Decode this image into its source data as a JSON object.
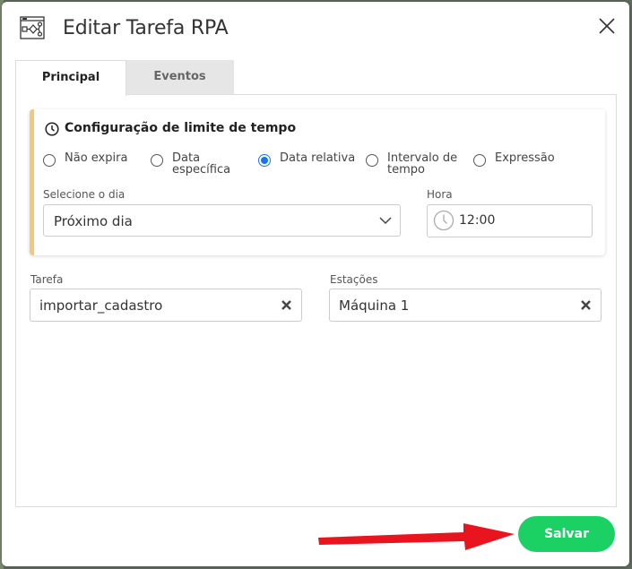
{
  "dialog": {
    "title": "Editar Tarefa RPA",
    "icons": {
      "title_icon": "workflow-diagram-icon",
      "close": "close-icon"
    }
  },
  "tabs": [
    {
      "label": "Principal",
      "active": true
    },
    {
      "label": "Eventos",
      "active": false
    }
  ],
  "time_limit": {
    "title": "Configuração de limite de tempo",
    "options": [
      {
        "label": "Não expira",
        "checked": false
      },
      {
        "label": "Data\nespecífica",
        "checked": false
      },
      {
        "label": "Data relativa",
        "checked": true
      },
      {
        "label": "Intervalo de\ntempo",
        "checked": false
      },
      {
        "label": "Expressão",
        "checked": false
      }
    ],
    "day_label": "Selecione o dia",
    "day_value": "Próximo dia",
    "hour_label": "Hora",
    "hour_value": "12:00"
  },
  "task": {
    "label": "Tarefa",
    "value": "importar_cadastro"
  },
  "stations": {
    "label": "Estações",
    "value": "Máquina 1"
  },
  "actions": {
    "save_label": "Salvar"
  },
  "colors": {
    "accent": "#1bd164",
    "radio": "#1a73e8",
    "card_border": "#f5c77a",
    "annotation_arrow": "#e8141e"
  }
}
